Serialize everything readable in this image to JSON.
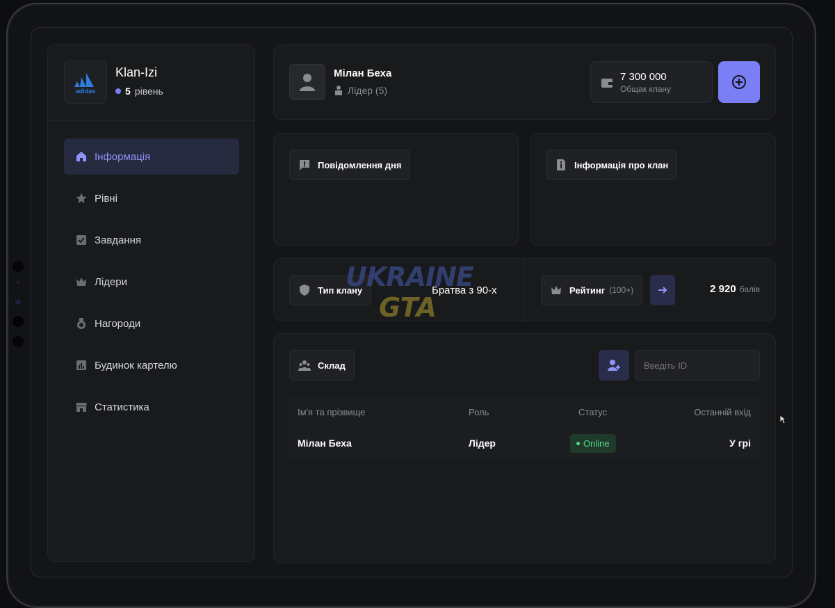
{
  "clan": {
    "name": "Klan-Izi",
    "level_num": "5",
    "level_word": "рівень",
    "logo_text": "adidas"
  },
  "nav": [
    {
      "label": "Інформація",
      "icon": "home-icon",
      "active": true
    },
    {
      "label": "Рівні",
      "icon": "star-icon"
    },
    {
      "label": "Завдання",
      "icon": "checkbox-icon"
    },
    {
      "label": "Лідери",
      "icon": "crown-icon"
    },
    {
      "label": "Нагороди",
      "icon": "medal-icon"
    },
    {
      "label": "Будинок картелю",
      "icon": "chart-icon"
    },
    {
      "label": "Статистика",
      "icon": "store-icon"
    }
  ],
  "member": {
    "name": "Мілан Беха",
    "role": "Лідер (5)"
  },
  "balance": {
    "amount": "7 300 000",
    "label": "Общак клану"
  },
  "cards": {
    "message_of_day": "Повідомлення дня",
    "clan_info": "Інформація про клан"
  },
  "clan_type": {
    "label": "Тип клану",
    "value": "Братва з 90-х"
  },
  "rating": {
    "label": "Рейтинг",
    "sub": "(100+)",
    "points": "2 920",
    "points_unit": "балів"
  },
  "warehouse": {
    "label": "Склад",
    "id_placeholder": "Введіть ID"
  },
  "table": {
    "headers": [
      "Ім'я та прізвище",
      "Роль",
      "Статус",
      "Останній вхід"
    ],
    "rows": [
      {
        "name": "Мілан Беха",
        "role": "Лідер",
        "status": "Online",
        "last": "У грі"
      }
    ]
  },
  "watermark": {
    "line1": "UKRAINE",
    "line2": "GTA"
  },
  "colors": {
    "accent": "#7b7ff5",
    "online": "#5bd68a",
    "bg": "#141517"
  }
}
